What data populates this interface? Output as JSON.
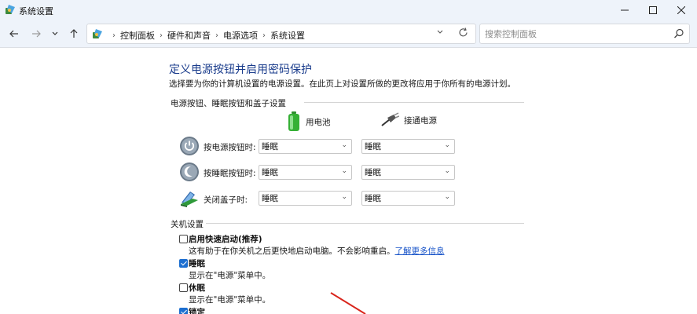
{
  "window": {
    "title": "系统设置"
  },
  "nav": {
    "breadcrumbs": [
      "控制面板",
      "硬件和声音",
      "电源选项",
      "系统设置"
    ],
    "search_placeholder": "搜索控制面板"
  },
  "page": {
    "title": "定义电源按钮并启用密码保护",
    "description": "选择要为你的计算机设置的电源设置。在此页上对设置所做的更改将应用于你所有的电源计划。"
  },
  "power_section": {
    "heading": "电源按钮、睡眠按钮和盖子设置",
    "columns": [
      "用电池",
      "接通电源"
    ],
    "rows": [
      {
        "label": "按电源按钮时:",
        "battery": "睡眠",
        "plugged": "睡眠"
      },
      {
        "label": "按睡眠按钮时:",
        "battery": "睡眠",
        "plugged": "睡眠"
      },
      {
        "label": "关闭盖子时:",
        "battery": "睡眠",
        "plugged": "睡眠"
      }
    ]
  },
  "shutdown_section": {
    "heading": "关机设置",
    "items": [
      {
        "label": "启用快速启动(推荐)",
        "checked": false,
        "desc": "这有助于在你关机之后更快地启动电脑。不会影响重启。",
        "link": "了解更多信息"
      },
      {
        "label": "睡眠",
        "checked": true,
        "desc": "显示在\"电源\"菜单中。"
      },
      {
        "label": "休眠",
        "checked": false,
        "desc": "显示在\"电源\"菜单中。"
      },
      {
        "label": "锁定",
        "checked": true
      }
    ]
  }
}
